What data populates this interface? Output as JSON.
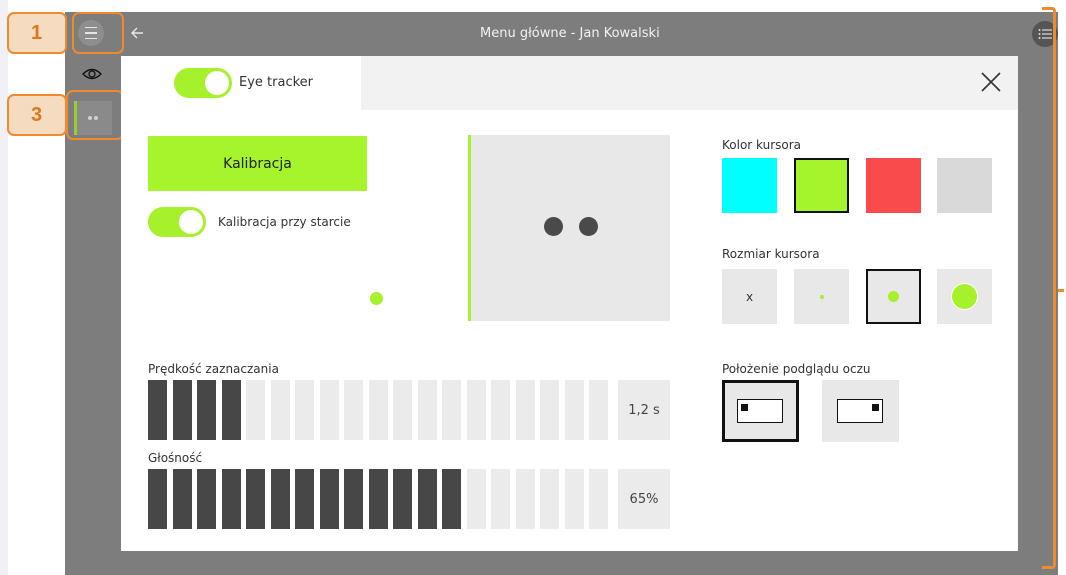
{
  "header": {
    "title": "Menu główne - Jan Kowalski",
    "menu_icon": "hamburger-icon",
    "back_icon": "arrow-left-icon",
    "list_icon": "list-icon"
  },
  "sidebar": {
    "items": [
      {
        "icon": "eye-icon"
      },
      {
        "icon": "two-dots-icon",
        "selected": true
      }
    ]
  },
  "annotations": {
    "badge_1": "1",
    "badge_3": "3",
    "accent": "#f08a30"
  },
  "dialog": {
    "tab_label": "Eye tracker",
    "tab_toggle_on": true,
    "close_icon": "close-icon",
    "calibrate_button": "Kalibracja",
    "calibrate_on_start_label": "Kalibracja przy starcie",
    "calibrate_on_start_on": true,
    "cursor_color_label": "Kolor kursora",
    "cursor_colors": [
      "#00ffff",
      "#a6f42c",
      "#f94b4b",
      "#d9d9d9"
    ],
    "cursor_color_selected": 1,
    "cursor_size_label": "Rozmiar kursora",
    "cursor_size_options": [
      "x",
      "small",
      "medium",
      "large"
    ],
    "cursor_size_selected": 2,
    "eye_preview_position_label": "Położenie podglądu oczu",
    "eye_preview_positions": [
      "left",
      "right"
    ],
    "eye_preview_position_selected": 0,
    "selection_speed_label": "Prędkość zaznaczania",
    "selection_speed_value": "1,2 s",
    "selection_speed_filled": 4,
    "volume_label": "Głośność",
    "volume_value": "65%",
    "volume_filled": 13,
    "segments_total": 20,
    "accent_color": "#a6f02c"
  }
}
